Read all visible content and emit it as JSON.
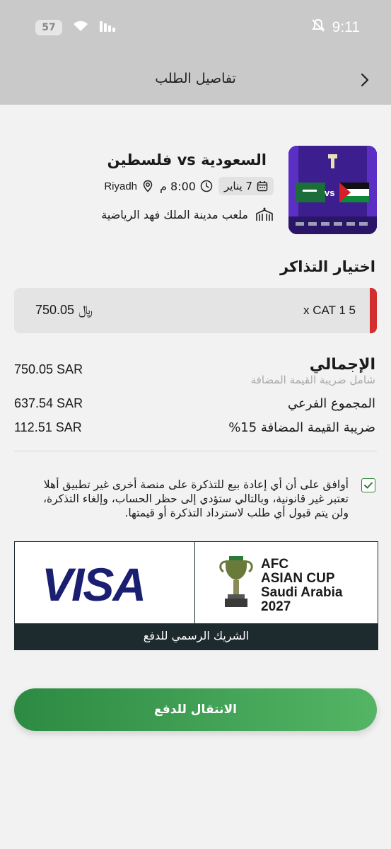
{
  "status_bar": {
    "battery": "57",
    "time": "9:11"
  },
  "header": {
    "title": "تفاصيل الطلب"
  },
  "event": {
    "title": "السعودية vs فلسطين",
    "date": "7 يناير",
    "time": "8:00 م",
    "city": "Riyadh",
    "venue": "ملعب مدينة الملك فهد الرياضية",
    "image_vs": "vs"
  },
  "tickets": {
    "section_title": "اختيار التذاكر",
    "items": [
      {
        "label": "x CAT 1 5",
        "price": "750.05",
        "currency_symbol": "﷼"
      }
    ]
  },
  "summary": {
    "total_label": "الإجمالي",
    "total_sub": "شامل ضريبة القيمة المضافة",
    "total_value": "750.05 SAR",
    "subtotal_label": "المجموع الفرعي",
    "subtotal_value": "637.54 SAR",
    "vat_label": "ضريبة القيمة المضافة 15%",
    "vat_value": "112.51 SAR"
  },
  "terms": {
    "checked": true,
    "text": "أوافق على أن أي إعادة بيع للتذكرة على منصة أخرى غير تطبيق أهلا تعتبر غير قانونية، وبالتالي ستؤدي إلى حظر الحساب، وإلغاء التذكرة، ولن يتم قبول أي طلب لاسترداد التذكرة أو قيمتها."
  },
  "partner": {
    "visa": "VISA",
    "afc_line1": "AFC",
    "afc_line2": "ASIAN CUP",
    "afc_line3": "Saudi Arabia",
    "afc_line4": "2027",
    "caption": "الشريك الرسمي للدفع"
  },
  "cta": {
    "label": "الانتقال للدفع"
  },
  "colors": {
    "accent_green": "#3a9d51",
    "ticket_accent": "#d32f2f",
    "visa_blue": "#1a1f71",
    "partner_dark": "#1d2b2f"
  }
}
